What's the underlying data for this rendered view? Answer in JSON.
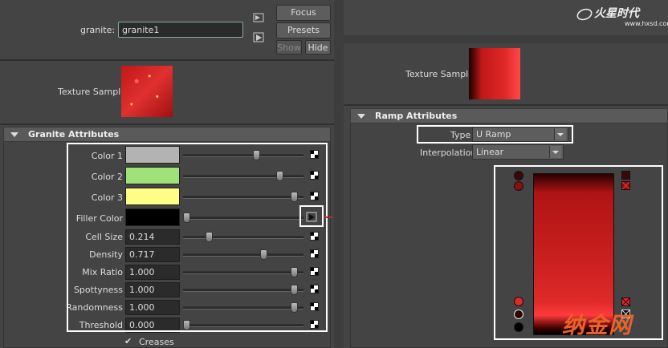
{
  "left": {
    "node_label": "granite:",
    "node_name": "granite1",
    "buttons": {
      "focus": "Focus",
      "presets": "Presets",
      "show": "Show",
      "hide": "Hide"
    },
    "texture_sample_label": "Texture Sample",
    "section_title": "Granite Attributes",
    "attributes": [
      {
        "label": "Color 1",
        "type": "color",
        "color": "#b3b3b3",
        "slider": 0.62
      },
      {
        "label": "Color 2",
        "type": "color",
        "color": "#9fe27a",
        "slider": 0.82
      },
      {
        "label": "Color 3",
        "type": "color",
        "color": "#feff84",
        "slider": 0.95
      },
      {
        "label": "Filler Color",
        "type": "color",
        "color": "#000000",
        "slider": 0.0
      },
      {
        "label": "Cell Size",
        "type": "num",
        "value": "0.214",
        "slider": 0.2
      },
      {
        "label": "Density",
        "type": "num",
        "value": "0.717",
        "slider": 0.68
      },
      {
        "label": "Mix Ratio",
        "type": "num",
        "value": "1.000",
        "slider": 0.95
      },
      {
        "label": "Spottyness",
        "type": "num",
        "value": "1.000",
        "slider": 0.95
      },
      {
        "label": "Randomness",
        "type": "num",
        "value": "1.000",
        "slider": 0.95
      },
      {
        "label": "Threshold",
        "type": "num",
        "value": "0.000",
        "slider": 0.0
      }
    ],
    "creases_label": "Creases",
    "creases_checked": true
  },
  "right": {
    "watermark_top": "火星时代",
    "watermark_url": "www.hxsd.com",
    "texture_sample_label": "Texture Sample",
    "section_title": "Ramp Attributes",
    "type_label": "Type",
    "type_value": "U Ramp",
    "interp_label": "Interpolation",
    "interp_value": "Linear",
    "watermark_bottom": "纳金网"
  },
  "colors": {
    "highlight": "#ffffff",
    "arrow": "#e02020",
    "ramp_top": "#2a0000",
    "ramp_mid": "#c81e1e",
    "ramp_bottom": "#ff3a3a"
  }
}
